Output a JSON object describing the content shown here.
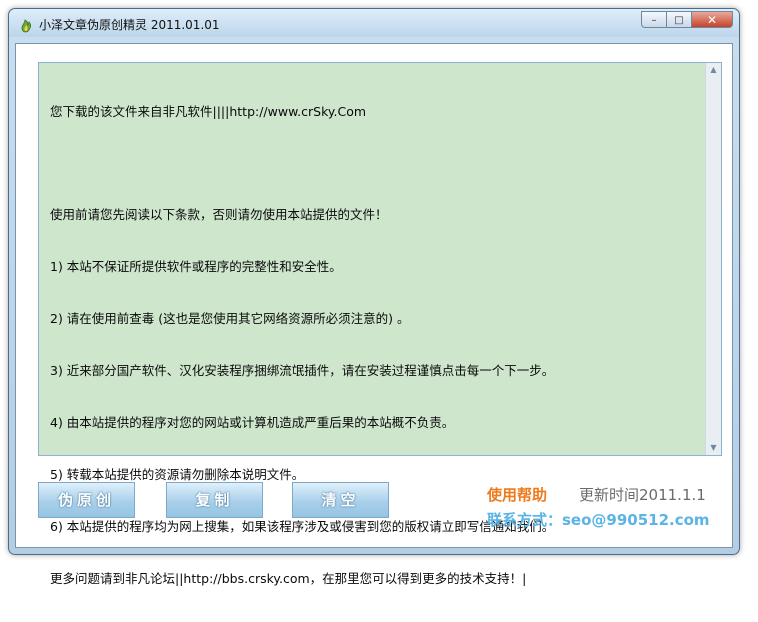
{
  "window": {
    "title": "小泽文章伪原创精灵 2011.01.01",
    "controls": {
      "minimize": "–",
      "maximize": "□",
      "close": "✕"
    }
  },
  "editor": {
    "lines": [
      "您下载的该文件来自非凡软件||||http://www.crSky.Com",
      "",
      "使用前请您先阅读以下条款，否则请勿使用本站提供的文件！",
      "1) 本站不保证所提供软件或程序的完整性和安全性。",
      "2) 请在使用前查毒 (这也是您使用其它网络资源所必须注意的) 。",
      "3) 近来部分国产软件、汉化安装程序捆绑流氓插件，请在安装过程谨慎点击每一个下一步。",
      "4) 由本站提供的程序对您的网站或计算机造成严重后果的本站概不负责。",
      "5) 转载本站提供的资源请勿删除本说明文件。",
      "6) 本站提供的程序均为网上搜集，如果该程序涉及或侵害到您的版权请立即写信通知我们。",
      "更多问题请到非凡论坛||http://bbs.crsky.com，在那里您可以得到更多的技术支持！|"
    ]
  },
  "buttons": {
    "pseudo_original": "伪原创",
    "copy": "复制",
    "clear": "清空"
  },
  "info": {
    "help": "使用帮助",
    "update": "更新时间2011.1.1",
    "contact": "联系方式：seo@990512.com"
  },
  "colors": {
    "editor_bg": "#cde6cc",
    "help": "#ee7a1c",
    "contact": "#5ab4e6"
  }
}
